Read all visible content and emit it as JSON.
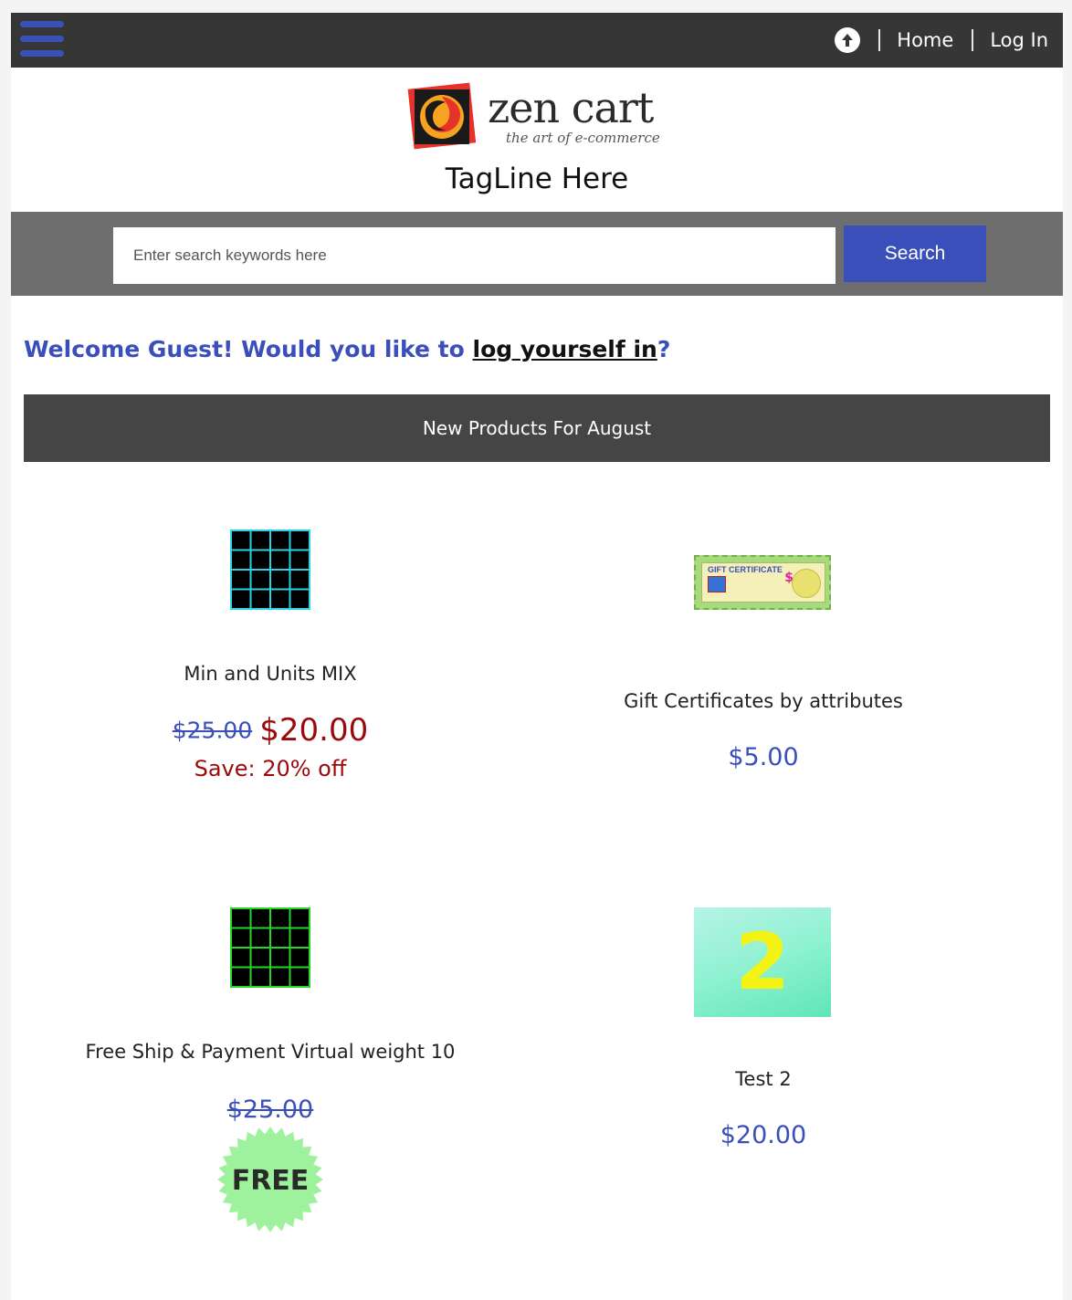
{
  "topbar": {
    "nav": [
      {
        "label": "Home"
      },
      {
        "label": "Log In"
      }
    ]
  },
  "header": {
    "logo_text": "zen cart",
    "logo_subtext": "the art of e-commerce",
    "tagline": "TagLine Here"
  },
  "search": {
    "placeholder": "Enter search keywords here",
    "button_label": "Search"
  },
  "welcome": {
    "prefix": "Welcome Guest! Would you like to ",
    "link_text": "log yourself in",
    "suffix": "?"
  },
  "section_title": "New Products For August",
  "products": [
    {
      "name": "Min and Units MIX",
      "old_price": "$25.00",
      "special_price": "$20.00",
      "save_text": "Save: 20% off",
      "image": "cyan-grid"
    },
    {
      "name": "Gift Certificates by attributes",
      "price": "$5.00",
      "image": "gift-certificate",
      "image_text": "GIFT CERTIFICATE"
    },
    {
      "name": "Free Ship & Payment Virtual weight 10",
      "old_price": "$25.00",
      "badge_text": "FREE",
      "image": "green-grid"
    },
    {
      "name": "Test 2",
      "price": "$20.00",
      "image": "number-2",
      "image_text": "2"
    }
  ],
  "colors": {
    "accent_blue": "#3a4fb9",
    "topbar": "#363636",
    "searchbar": "#6e6e6e",
    "section_title_bg": "#454545",
    "sale_red": "#9b0a0a",
    "free_badge": "#9ef29e"
  }
}
